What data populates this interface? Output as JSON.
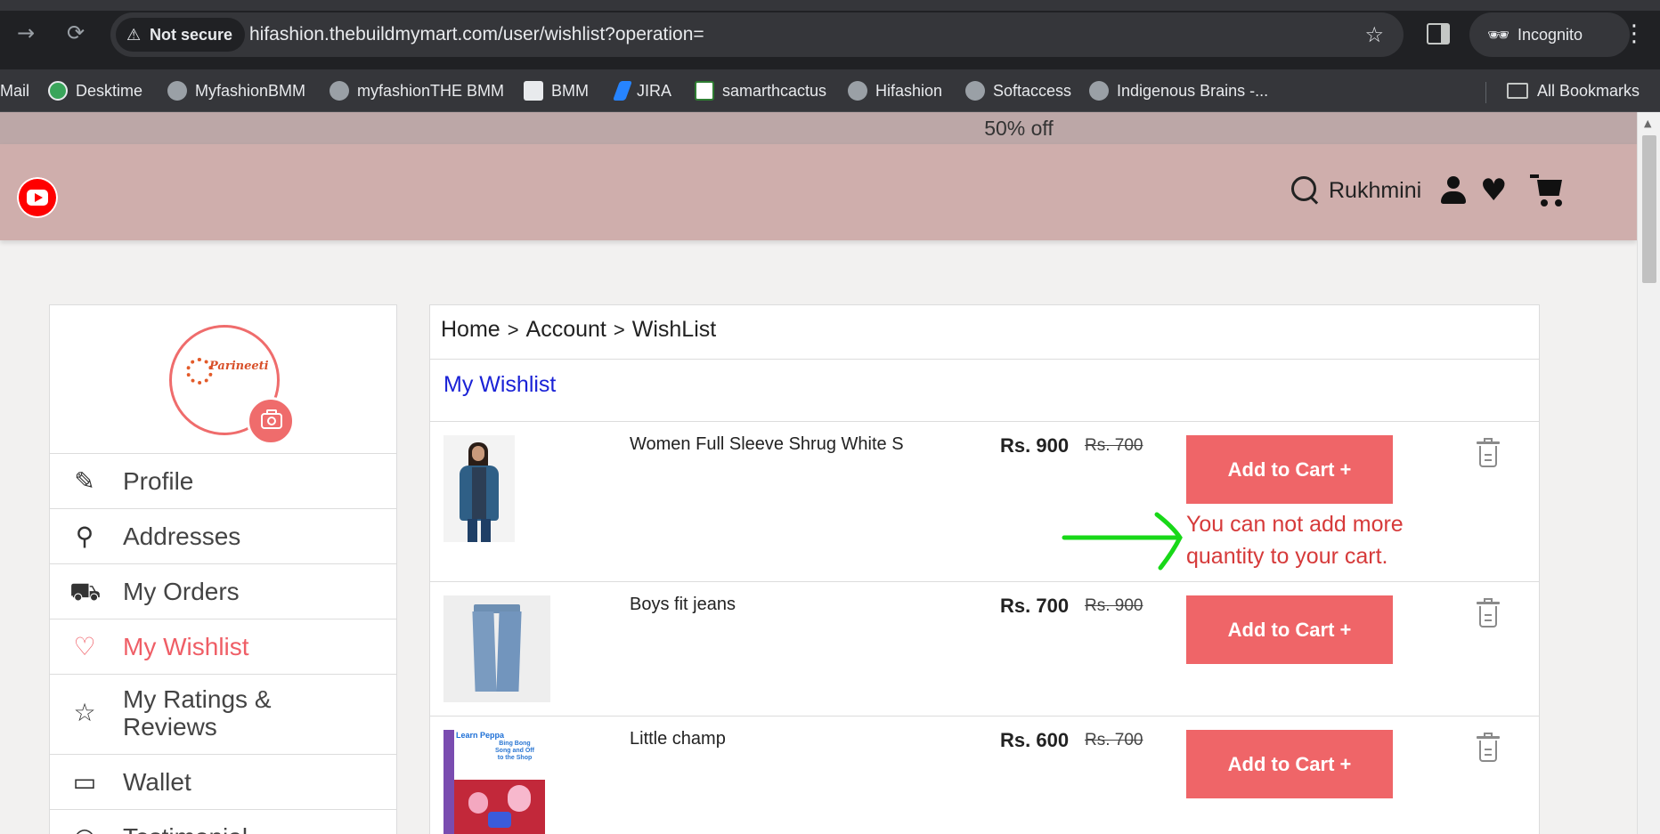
{
  "browser": {
    "security_label": "Not secure",
    "url": "hifashion.thebuildmymart.com/user/wishlist?operation=",
    "profile_label": "Incognito",
    "bookmarks": [
      "Mail",
      "Desktime",
      "MyfashionBMM",
      "myfashionTHE BMM",
      "BMM",
      "JIRA",
      "samarthcactus",
      "Hifashion",
      "Softaccess",
      "Indigenous Brains -..."
    ],
    "all_bookmarks_label": "All Bookmarks"
  },
  "site": {
    "promo_text": "50% off",
    "user_name": "Rukhmini",
    "brand_colors": {
      "header": "#cfaeac",
      "promo": "#bca7a7",
      "accent": "#ef6568",
      "link": "#1a22d6"
    }
  },
  "sidebar": {
    "avatar": {
      "logo_text": "Parineeti",
      "logo_tagline": ""
    },
    "items": [
      {
        "label": "Profile",
        "icon": "edit-icon",
        "active": false
      },
      {
        "label": "Addresses",
        "icon": "location-pin-icon",
        "active": false
      },
      {
        "label": "My Orders",
        "icon": "cart-icon",
        "active": false
      },
      {
        "label": "My Wishlist",
        "icon": "heart-icon",
        "active": true
      },
      {
        "label": "My Ratings & Reviews",
        "icon": "star-icon",
        "active": false
      },
      {
        "label": "Wallet",
        "icon": "wallet-icon",
        "active": false
      },
      {
        "label": "Testimonial",
        "icon": "testimonial-icon",
        "active": false
      }
    ]
  },
  "breadcrumb": {
    "home": "Home",
    "account": "Account",
    "current": "WishList",
    "separator": ">"
  },
  "wishlist": {
    "title": "My Wishlist",
    "add_to_cart_label": "Add to Cart +",
    "items": [
      {
        "name": "Women Full Sleeve Shrug White S",
        "price": "Rs. 900",
        "mrp": "Rs. 700",
        "error": "You can not add more quantity to your cart."
      },
      {
        "name": "Boys fit jeans",
        "price": "Rs. 700",
        "mrp": "Rs. 900",
        "error": ""
      },
      {
        "name": "Little champ",
        "price": "Rs. 600",
        "mrp": "Rs. 700",
        "error": ""
      }
    ],
    "book_cover": {
      "title": "Learn Peppa",
      "subtitle": "Bing Bong Song and Off to the Shop"
    }
  }
}
